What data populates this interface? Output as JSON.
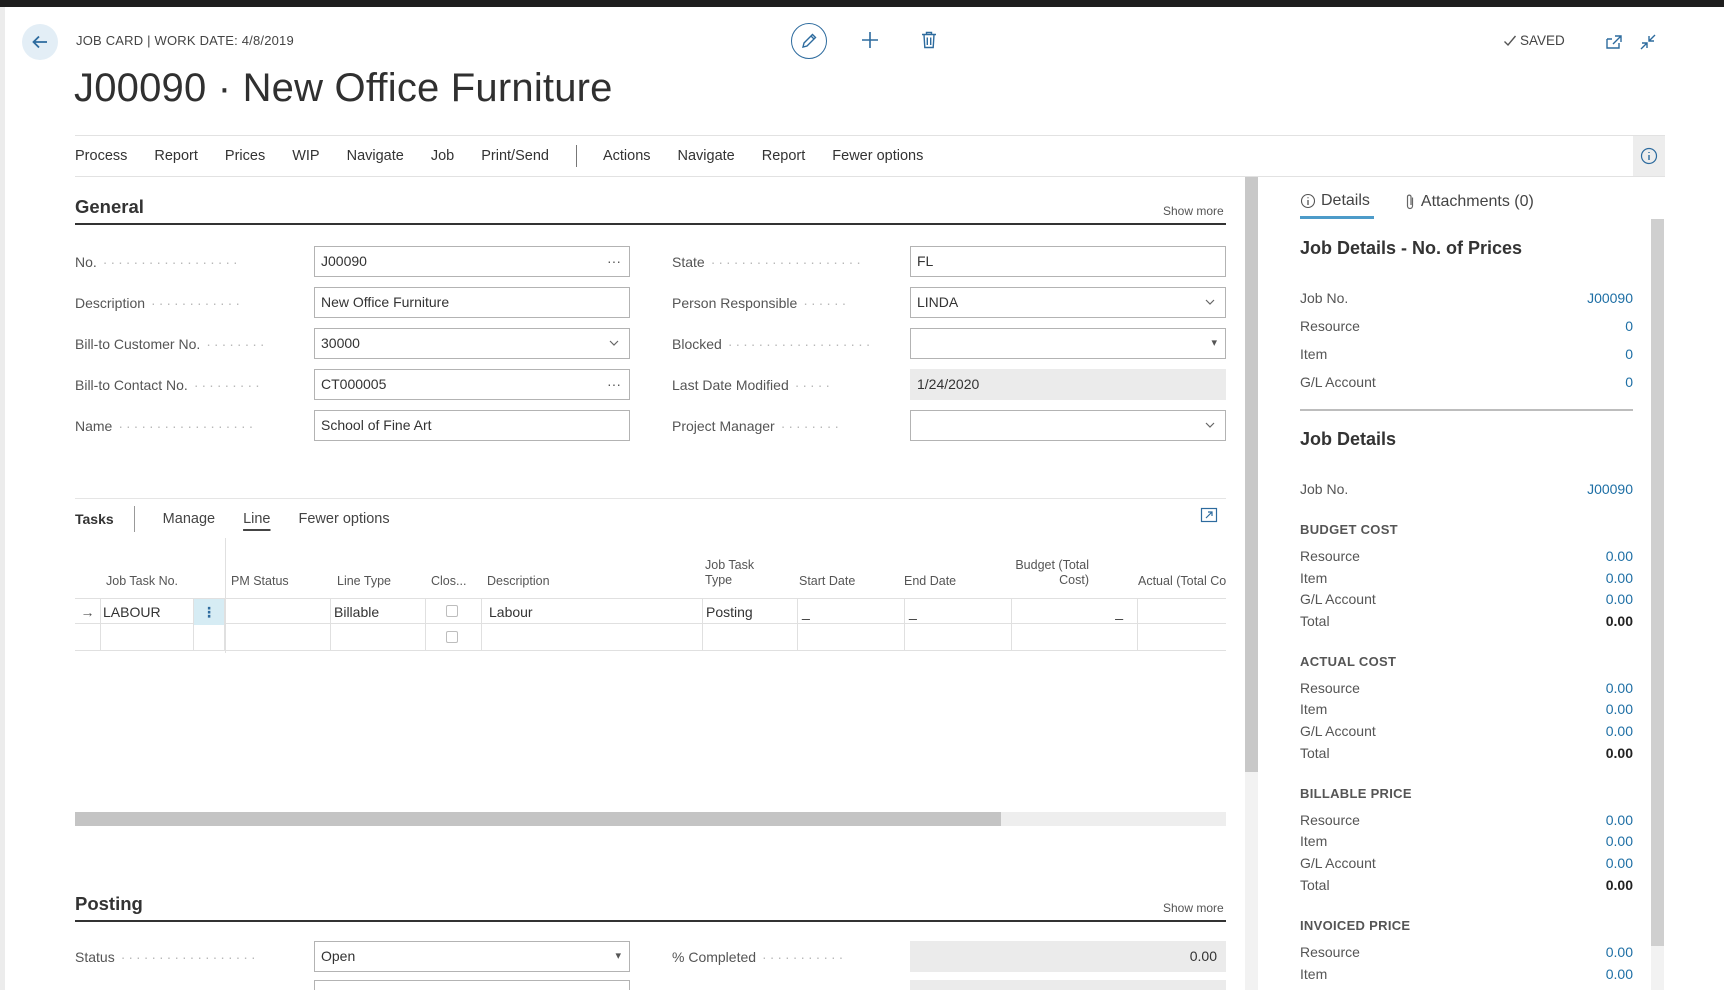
{
  "header": {
    "breadcrumb": "JOB CARD | WORK DATE: 4/8/2019",
    "title": "J00090 · New Office Furniture",
    "saved_label": "SAVED"
  },
  "actionbar": {
    "items_left": [
      "Process",
      "Report",
      "Prices",
      "WIP",
      "Navigate",
      "Job",
      "Print/Send"
    ],
    "items_right": [
      "Actions",
      "Navigate",
      "Report",
      "Fewer options"
    ]
  },
  "general": {
    "title": "General",
    "show_more": "Show more",
    "fields_left": [
      {
        "label": "No.",
        "value": "J00090",
        "control": "ellipsis",
        "suffix": "···"
      },
      {
        "label": "Description",
        "value": "New Office Furniture",
        "control": "text"
      },
      {
        "label": "Bill-to Customer No.",
        "value": "30000",
        "control": "dropdown"
      },
      {
        "label": "Bill-to Contact No.",
        "value": "CT000005",
        "control": "ellipsis",
        "suffix": "···"
      },
      {
        "label": "Name",
        "value": "School of Fine Art",
        "control": "text"
      }
    ],
    "fields_right": [
      {
        "label": "State",
        "value": "FL",
        "control": "text"
      },
      {
        "label": "Person Responsible",
        "value": "LINDA",
        "control": "dropdown"
      },
      {
        "label": "Blocked",
        "value": "",
        "control": "select",
        "suffix": "▾"
      },
      {
        "label": "Last Date Modified",
        "value": "1/24/2020",
        "control": "readonly"
      },
      {
        "label": "Project Manager",
        "value": "",
        "control": "dropdown"
      }
    ]
  },
  "tasks": {
    "title": "Tasks",
    "actions": [
      "Manage",
      "Line",
      "Fewer options"
    ],
    "active_action": "Line",
    "columns": [
      "Job Task No.",
      "PM Status",
      "Line Type",
      "Clos...",
      "Description",
      "Job Task Type",
      "Start Date",
      "End Date",
      "Budget (Total Cost)",
      "Actual (Total Co"
    ],
    "rows": [
      {
        "job_task_no": "LABOUR",
        "pm_status": "",
        "line_type": "Billable",
        "description": "Labour",
        "job_task_type": "Posting",
        "start_date": "_",
        "end_date": "_",
        "budget": "_",
        "actual": ""
      },
      {
        "job_task_no": "",
        "pm_status": "",
        "line_type": "",
        "description": "",
        "job_task_type": "",
        "start_date": "",
        "end_date": "",
        "budget": "",
        "actual": ""
      }
    ],
    "row_arrow": "→",
    "row_menu": "⋮"
  },
  "posting": {
    "title": "Posting",
    "show_more": "Show more",
    "status_label": "Status",
    "status_value": "Open",
    "status_suffix": "▾",
    "completed_label": "% Completed",
    "completed_value": "0.00"
  },
  "factbox": {
    "tabs": [
      {
        "label": "Details",
        "icon": "info-icon"
      },
      {
        "label": "Attachments (0)",
        "icon": "paperclip-icon"
      }
    ],
    "prices_title": "Job Details - No. of Prices",
    "prices_rows": [
      {
        "label": "Job No.",
        "value": "J00090"
      },
      {
        "label": "Resource",
        "value": "0"
      },
      {
        "label": "Item",
        "value": "0"
      },
      {
        "label": "G/L Account",
        "value": "0"
      }
    ],
    "details_title": "Job Details",
    "details_job_label": "Job No.",
    "details_job_value": "J00090",
    "groups": [
      {
        "title": "BUDGET COST",
        "rows": [
          {
            "label": "Resource",
            "value": "0.00"
          },
          {
            "label": "Item",
            "value": "0.00"
          },
          {
            "label": "G/L Account",
            "value": "0.00"
          },
          {
            "label": "Total",
            "value": "0.00"
          }
        ]
      },
      {
        "title": "ACTUAL COST",
        "rows": [
          {
            "label": "Resource",
            "value": "0.00"
          },
          {
            "label": "Item",
            "value": "0.00"
          },
          {
            "label": "G/L Account",
            "value": "0.00"
          },
          {
            "label": "Total",
            "value": "0.00"
          }
        ]
      },
      {
        "title": "BILLABLE PRICE",
        "rows": [
          {
            "label": "Resource",
            "value": "0.00"
          },
          {
            "label": "Item",
            "value": "0.00"
          },
          {
            "label": "G/L Account",
            "value": "0.00"
          },
          {
            "label": "Total",
            "value": "0.00"
          }
        ]
      },
      {
        "title": "INVOICED PRICE",
        "rows": [
          {
            "label": "Resource",
            "value": "0.00"
          },
          {
            "label": "Item",
            "value": "0.00"
          }
        ]
      }
    ]
  },
  "colors": {
    "accent": "#1e6fa5",
    "tab_underline": "#4d9bc9",
    "back_bg": "#e3eef6"
  }
}
